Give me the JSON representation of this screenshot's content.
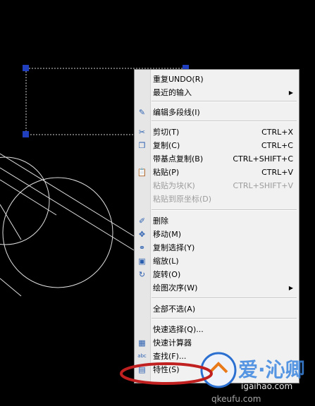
{
  "menu": {
    "items": [
      {
        "label": "重复UNDO(R)",
        "shortcut": "",
        "icon": "",
        "disabled": false,
        "submenu": false
      },
      {
        "label": "最近的输入",
        "shortcut": "",
        "icon": "",
        "disabled": false,
        "submenu": true
      },
      {
        "label": "编辑多段线(I)",
        "shortcut": "",
        "icon": "polyline-edit-icon",
        "disabled": false,
        "submenu": false
      },
      {
        "label": "剪切(T)",
        "shortcut": "CTRL+X",
        "icon": "scissors-icon",
        "disabled": false,
        "submenu": false
      },
      {
        "label": "复制(C)",
        "shortcut": "CTRL+C",
        "icon": "copy-icon",
        "disabled": false,
        "submenu": false
      },
      {
        "label": "带基点复制(B)",
        "shortcut": "CTRL+SHIFT+C",
        "icon": "",
        "disabled": false,
        "submenu": false
      },
      {
        "label": "粘贴(P)",
        "shortcut": "CTRL+V",
        "icon": "paste-icon",
        "disabled": false,
        "submenu": false
      },
      {
        "label": "粘贴为块(K)",
        "shortcut": "CTRL+SHIFT+V",
        "icon": "",
        "disabled": true,
        "submenu": false
      },
      {
        "label": "粘贴到原坐标(D)",
        "shortcut": "",
        "icon": "",
        "disabled": true,
        "submenu": false
      },
      {
        "label": "删除",
        "shortcut": "",
        "icon": "eraser-icon",
        "disabled": false,
        "submenu": false
      },
      {
        "label": "移动(M)",
        "shortcut": "",
        "icon": "move-icon",
        "disabled": false,
        "submenu": false
      },
      {
        "label": "复制选择(Y)",
        "shortcut": "",
        "icon": "copy-selection-icon",
        "disabled": false,
        "submenu": false
      },
      {
        "label": "缩放(L)",
        "shortcut": "",
        "icon": "scale-icon",
        "disabled": false,
        "submenu": false
      },
      {
        "label": "旋转(O)",
        "shortcut": "",
        "icon": "rotate-icon",
        "disabled": false,
        "submenu": false
      },
      {
        "label": "绘图次序(W)",
        "shortcut": "",
        "icon": "",
        "disabled": false,
        "submenu": true
      },
      {
        "label": "全部不选(A)",
        "shortcut": "",
        "icon": "",
        "disabled": false,
        "submenu": false
      },
      {
        "label": "快速选择(Q)...",
        "shortcut": "",
        "icon": "",
        "disabled": false,
        "submenu": false
      },
      {
        "label": "快速计算器",
        "shortcut": "",
        "icon": "calculator-icon",
        "disabled": false,
        "submenu": false
      },
      {
        "label": "查找(F)...",
        "shortcut": "",
        "icon": "find-icon",
        "disabled": false,
        "submenu": false
      },
      {
        "label": "特性(S)",
        "shortcut": "",
        "icon": "properties-icon",
        "disabled": false,
        "submenu": false
      }
    ]
  },
  "watermark": {
    "text_main": "爱·沁卿",
    "text_url": "igaihao.com",
    "text_sub": "qkeufu.com"
  },
  "colors": {
    "highlight_circle": "#c02020",
    "selection_grip": "#1f3fbf"
  }
}
